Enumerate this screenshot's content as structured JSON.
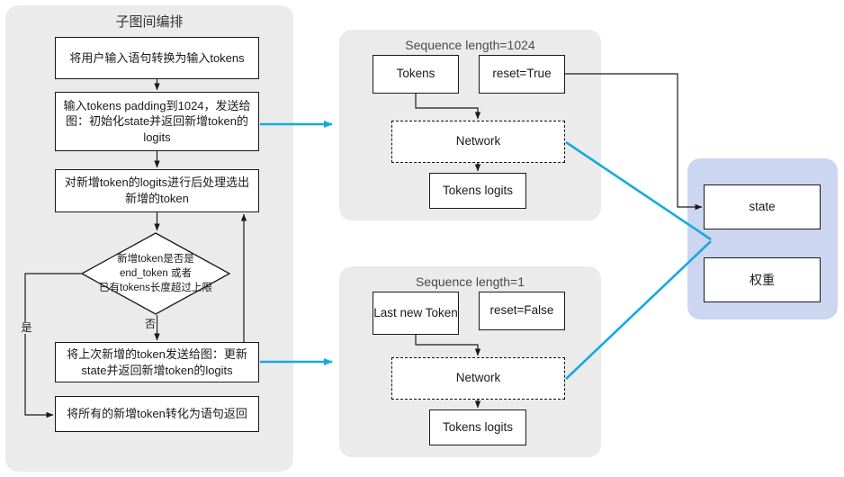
{
  "panels": {
    "left": {
      "title": "子图间编排"
    },
    "seq1024": {
      "title": "Sequence length=1024"
    },
    "seq1": {
      "title": "Sequence length=1"
    },
    "shared": {
      "title": ""
    }
  },
  "flowchart": {
    "box1": "将用户输入语句转换为输入tokens",
    "box2": "输入tokens padding到1024，发送给图：初始化state并返回新增token的logits",
    "box3": "对新增token的logits进行后处理选出新增的token",
    "decision": {
      "line1": "新增token是否是",
      "line2": "end_token 或者",
      "line3": "已有tokens长度超过上限"
    },
    "box5": "将上次新增的token发送给图：更新state并返回新增token的logits",
    "box6": "将所有的新增token转化为语句返回",
    "labels": {
      "yes": "是",
      "no": "否"
    }
  },
  "seq1024": {
    "tokens": "Tokens",
    "reset": "reset=True",
    "network": "Network",
    "logits": "Tokens logits"
  },
  "seq1": {
    "token": "Last new Token",
    "reset": "reset=False",
    "network": "Network",
    "logits": "Tokens logits"
  },
  "shared": {
    "state": "state",
    "weights": "权重"
  },
  "colors": {
    "panel_gray": "#ebebeb",
    "panel_blue": "#ccd6f0",
    "accent_cyan": "#15a9e1",
    "node_border": "#1a1a1a",
    "node_fill": "#ffffff",
    "title_text": "#4a4a4a"
  }
}
